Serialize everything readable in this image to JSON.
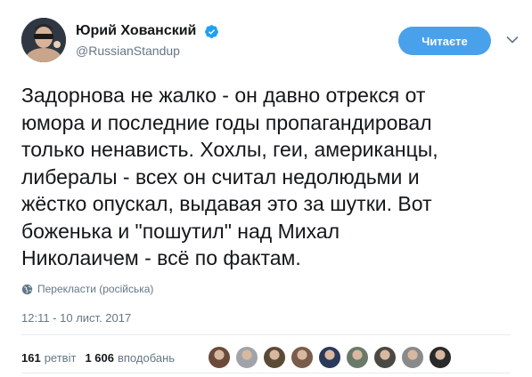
{
  "author": {
    "display_name": "Юрий Хованский",
    "handle": "@RussianStandup",
    "verified": true,
    "avatar_icon": "user-avatar-photo"
  },
  "follow_button": {
    "label": "Читаєте"
  },
  "tweet": {
    "text": "Задорнова не жалко - он давно отрекся от\nюмора и последние годы пропагандировал\nтолько ненависть. Хохлы, геи, американцы,\nлибералы - всех он считал недолюдьми и\nжёстко опускал, выдавая это за шутки. Вот\nбоженька и \"пошутил\" над Михал\nНиколаичем - всё по фактам.",
    "translate_label": "Перекласти (російська)",
    "timestamp": "12:11 - 10 лист. 2017"
  },
  "stats": {
    "retweets_count": "161",
    "retweets_label": "ретвіт",
    "likes_count": "1 606",
    "likes_label": "вподобань"
  },
  "liker_avatars": [
    {
      "name": "liker-avatar-1",
      "color": "#6b4a3a"
    },
    {
      "name": "liker-avatar-2",
      "color": "#a0a4a8"
    },
    {
      "name": "liker-avatar-3",
      "color": "#5a4a36"
    },
    {
      "name": "liker-avatar-4",
      "color": "#7a5c4a"
    },
    {
      "name": "liker-avatar-5",
      "color": "#2b3a5a"
    },
    {
      "name": "liker-avatar-6",
      "color": "#6a7a6a"
    },
    {
      "name": "liker-avatar-7",
      "color": "#4a4a44"
    },
    {
      "name": "liker-avatar-8",
      "color": "#8a8a8a"
    },
    {
      "name": "liker-avatar-9",
      "color": "#2a2a2a"
    }
  ],
  "colors": {
    "accent": "#4aa1eb",
    "text_primary": "#14171a",
    "text_secondary": "#657786",
    "divider": "#e6ecf0",
    "verified": "#1da1f2"
  }
}
